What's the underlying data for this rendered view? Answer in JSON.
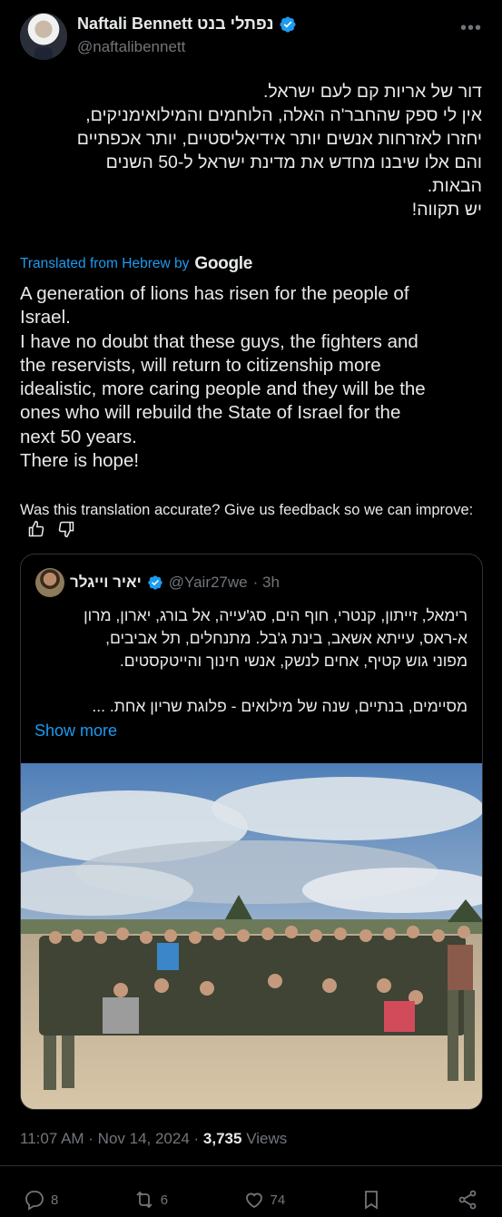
{
  "author": {
    "name": "Naftali Bennett נפתלי בנט",
    "handle": "@naftalibennett",
    "more": "•••"
  },
  "post": {
    "hebrew": "דור של אריות קם לעם ישראל.\nאין לי ספק שהחבר'ה האלה, הלוחמים והמילואימניקים,\nיחזרו לאזרחות אנשים יותר אידיאליסטיים, יותר אכפתיים\nוהם אלו שיבנו מחדש את מדינת ישראל ל-50 השנים\nהבאות.\nיש תקווה!",
    "translated_label": "Translated from Hebrew by",
    "translator": "Google",
    "english": "A generation of lions has risen for the people of\nIsrael.\nI have no doubt that these guys, the fighters and\nthe reservists, will return to citizenship more\nidealistic, more caring people and they will be the\nones who will rebuild the State of Israel for the\nnext 50 years.\nThere is hope!",
    "feedback": "Was this translation accurate? Give us feedback so we can improve:"
  },
  "quote": {
    "name": "יאיר וייגלר",
    "handle": "@Yair27we",
    "time": "· 3h",
    "text": "רימאל, זייתון, קנטרי, חוף הים, סג'עייה, אל בורג, יארון, מרון\nא-ראס, עייתא אשאב, בינת ג'בל. מתנחלים, תל אביבים,\nמפוני גוש קטיף, אחים לנשק, אנשי חינוך והייטקסטים.\n\nמסיימים, בנתיים, שנה של מילואים - פלוגת שריון אחת. ...",
    "show_more": "Show more"
  },
  "meta": {
    "time": "11:07 AM · Nov 14, 2024 · ",
    "views_count": "3,735",
    "views_label": " Views"
  },
  "actions": {
    "replies": "8",
    "reposts": "6",
    "likes": "74"
  },
  "colors": {
    "background": "#000000",
    "text": "#e7e9ea",
    "muted": "#71767b",
    "accent": "#1d9bf0",
    "border": "#2f3336"
  }
}
